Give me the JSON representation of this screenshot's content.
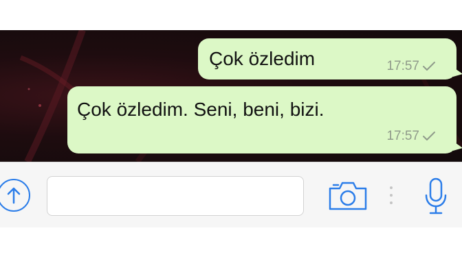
{
  "conversation": {
    "messages": [
      {
        "text": "Çok özledim",
        "time": "17:57",
        "status_icon": "single-check-icon",
        "direction": "outgoing"
      },
      {
        "text": "Çok özledim. Seni, beni, bizi.",
        "time": "17:57",
        "status_icon": "single-check-icon",
        "direction": "outgoing"
      }
    ]
  },
  "composer": {
    "input_value": "",
    "attach_icon": "upload-arrow-icon",
    "camera_icon": "camera-icon",
    "more_icon": "vertical-dots-icon",
    "mic_icon": "microphone-icon"
  },
  "colors": {
    "outgoing_bubble": "#dcf8c6",
    "accent": "#2b7de9",
    "timestamp": "#8f9a8a",
    "wallpaper": "#1e0c0f"
  }
}
